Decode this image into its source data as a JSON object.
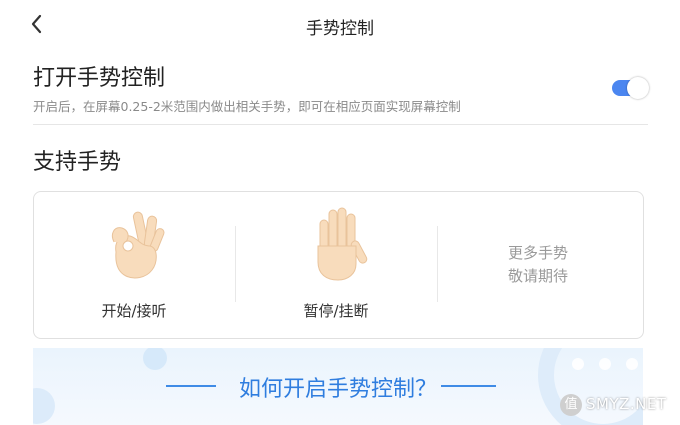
{
  "header": {
    "title": "手势控制",
    "back_icon": "chevron-left-icon"
  },
  "gesture_control": {
    "title": "打开手势控制",
    "description": "开启后，在屏幕0.25-2米范围内做出相关手势，即可在相应页面实现屏幕控制",
    "toggle_on": true,
    "accent_color": "#4b86f0"
  },
  "support": {
    "title": "支持手势",
    "gestures": [
      {
        "label": "开始/接听",
        "icon": "ok-hand-icon"
      },
      {
        "label": "暂停/挂断",
        "icon": "raised-palm-icon"
      }
    ],
    "more_line1": "更多手势",
    "more_line2": "敬请期待"
  },
  "banner": {
    "title": "如何开启手势控制？",
    "color": "#2f7ddf"
  },
  "watermark": {
    "symbol": "值",
    "text": "SMYZ.NET"
  }
}
